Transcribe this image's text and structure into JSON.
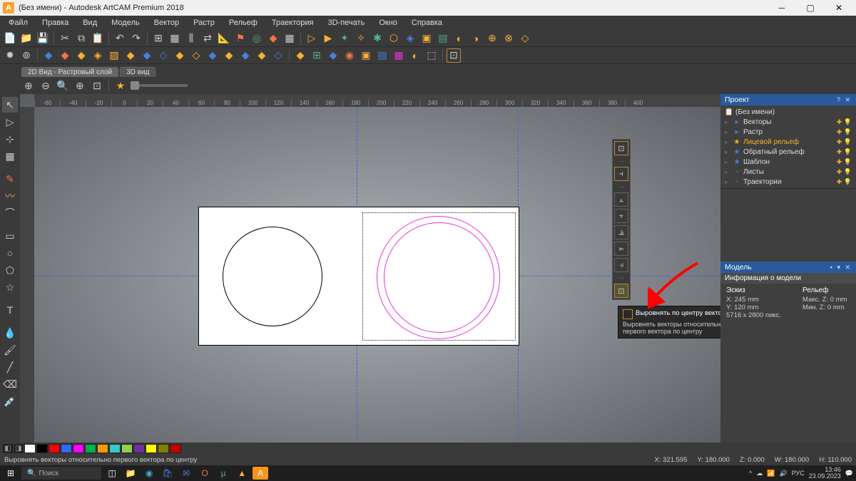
{
  "title": "(Без имени) - Autodesk ArtCAM Premium 2018",
  "menu": [
    "Файл",
    "Правка",
    "Вид",
    "Модель",
    "Вектор",
    "Растр",
    "Рельеф",
    "Траектория",
    "3D-печать",
    "Окно",
    "Справка"
  ],
  "tabs": {
    "active": "2D Вид - Растровый слой",
    "other": "3D вид"
  },
  "align_tooltip": {
    "title": "Выровнять по центру вектора",
    "body": "Выровнять векторы относительно первого вектора по центру"
  },
  "project": {
    "panel": "Проект",
    "root": "(Без имени)",
    "items": [
      {
        "label": "Векторы",
        "icon": "▸",
        "cls": ""
      },
      {
        "label": "Растр",
        "icon": "▸",
        "cls": ""
      },
      {
        "label": "Лицевой рельеф",
        "icon": "★",
        "cls": "hl"
      },
      {
        "label": "Обратный рельеф",
        "icon": "★",
        "cls": ""
      },
      {
        "label": "Шаблон",
        "icon": "★",
        "cls": ""
      },
      {
        "label": "Листы",
        "icon": "",
        "cls": ""
      },
      {
        "label": "Траектории",
        "icon": "",
        "cls": ""
      }
    ]
  },
  "model": {
    "panel": "Модель",
    "info_head": "Информация о модели",
    "sketch_label": "Эскиз",
    "relief_label": "Рельеф",
    "x": "X: 245 mm",
    "y": "Y: 120 mm",
    "px": "5716 x 2800 пикс.",
    "maxz": "Макс. Z: 0 mm",
    "minz": "Мин. Z: 0 mm"
  },
  "status": {
    "hint": "Выровнять векторы относительно первого вектора по центру",
    "x": "X: 321.595",
    "y": "Y: 180.000",
    "z": "Z: 0.000",
    "w": "W: 180.000",
    "h": "H: 110.000"
  },
  "taskbar": {
    "search": "Поиск",
    "lang": "РУС",
    "time": "13:46",
    "date": "23.09.2023"
  },
  "ruler_ticks": [
    "-60",
    "-40",
    "-20",
    "0",
    "20",
    "40",
    "60",
    "80",
    "100",
    "120",
    "140",
    "160",
    "180",
    "200",
    "220",
    "240",
    "260",
    "280",
    "300",
    "320",
    "340",
    "360",
    "380",
    "400"
  ],
  "colors": [
    "#ffffff",
    "#000000",
    "#ff0000",
    "#3366ff",
    "#ff00ff",
    "#00b050",
    "#ff9900",
    "#33cccc",
    "#92d050",
    "#7030a0",
    "#ffff00",
    "#808000",
    "#c00000"
  ]
}
